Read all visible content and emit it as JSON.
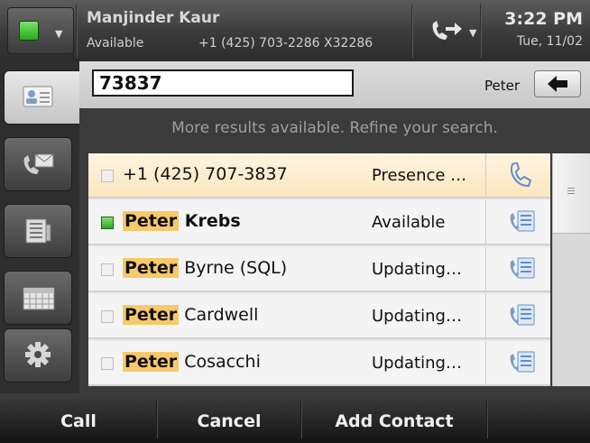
{
  "status_bar": {
    "user_name": "Manjinder Kaur",
    "presence": "Available",
    "phone_number": "+1 (425) 703-2286 X32286",
    "time": "3:22 PM",
    "date": "Tue, 11/02",
    "presence_color": "#2fb424"
  },
  "search": {
    "query": "73837",
    "hint": "Peter",
    "info": "More results available. Refine your search."
  },
  "results": [
    {
      "highlight": "",
      "rest": "+1 (425) 707-3837",
      "rest_bold": false,
      "status": "Presence …",
      "checkbox": "empty",
      "icon": "phone-icon"
    },
    {
      "highlight": "Peter",
      "rest": " Krebs",
      "rest_bold": true,
      "status": "Available",
      "checkbox": "green",
      "icon": "contact-card-icon"
    },
    {
      "highlight": "Peter",
      "rest": " Byrne (SQL)",
      "rest_bold": false,
      "status": "Updating…",
      "checkbox": "empty",
      "icon": "contact-card-icon"
    },
    {
      "highlight": "Peter",
      "rest": " Cardwell",
      "rest_bold": false,
      "status": "Updating…",
      "checkbox": "empty",
      "icon": "contact-card-icon"
    },
    {
      "highlight": "Peter",
      "rest": " Cosacchi",
      "rest_bold": false,
      "status": "Updating…",
      "checkbox": "empty",
      "icon": "contact-card-icon"
    }
  ],
  "left_rail": [
    {
      "icon": "contact-card-icon",
      "active": true
    },
    {
      "icon": "voicemail-icon",
      "active": false
    },
    {
      "icon": "call-log-icon",
      "active": false
    },
    {
      "icon": "calendar-icon",
      "active": false
    },
    {
      "icon": "gear-icon",
      "active": false
    }
  ],
  "softkeys": [
    {
      "label": "Call"
    },
    {
      "label": "Cancel"
    },
    {
      "label": "Add Contact"
    },
    {
      "label": ""
    }
  ],
  "colors": {
    "highlight": "#f7c96a",
    "selected_row": "#fbe6c0",
    "contact_icon_blue": "#5b8fd6"
  }
}
